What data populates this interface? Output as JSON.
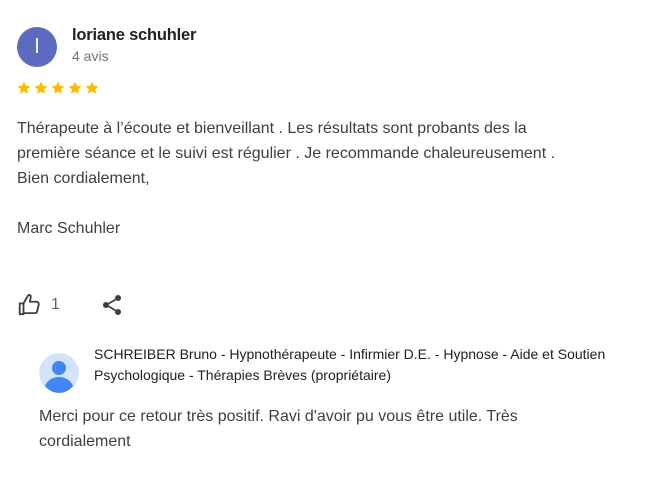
{
  "review": {
    "author_initial": "l",
    "author_name": "loriane schuhler",
    "author_meta": "4 avis",
    "rating": 5,
    "text_line1": "Thérapeute à l’écoute et bienveillant . Les résultats sont probants des la",
    "text_line2": "première séance et le suivi est régulier . Je recommande chaleureusement .",
    "text_line3": "Bien cordialement,",
    "text_line4": "Marc Schuhler",
    "like_count": "1"
  },
  "owner_response": {
    "name": "SCHREIBER Bruno - Hypnothérapeute - Infirmier D.E. - Hypnose - Aide et Soutien Psychologique - Thérapies Brèves (propriétaire)",
    "reply": "Merci pour ce retour très positif. Ravi d'avoir pu vous être utile. Très cordialement"
  },
  "colors": {
    "avatar_bg": "#5c6bc0",
    "star": "#fbbc04",
    "text": "#3c4043",
    "muted": "#70757a"
  },
  "icons": {
    "like": "thumb-up-icon",
    "share": "share-icon",
    "owner_avatar": "user-avatar-icon"
  }
}
